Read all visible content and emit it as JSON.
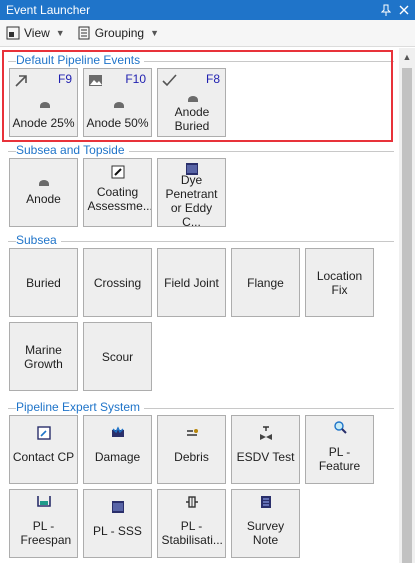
{
  "window": {
    "title": "Event Launcher",
    "pin_icon": "pin-icon",
    "close_icon": "close-icon"
  },
  "toolbar": {
    "view_label": "View",
    "grouping_label": "Grouping"
  },
  "groups": [
    {
      "title": "Default Pipeline Events",
      "tiles": [
        {
          "label": "Anode 25%",
          "key": "F9",
          "icon": "arrow-up-right-icon"
        },
        {
          "label": "Anode 50%",
          "key": "F10",
          "icon": "image-icon"
        },
        {
          "label": "Anode Buried",
          "key": "F8",
          "icon": "checkmark-icon"
        }
      ]
    },
    {
      "title": "Subsea and Topside",
      "tiles": [
        {
          "label": "Anode",
          "icon": "anode-icon"
        },
        {
          "label": "Coating Assessme...",
          "icon": "note-edit-icon"
        },
        {
          "label": "Dye Penetrant or Eddy C...",
          "icon": "wave-scan-icon"
        }
      ]
    },
    {
      "title": "Subsea",
      "tiles": [
        {
          "label": "Buried"
        },
        {
          "label": "Crossing"
        },
        {
          "label": "Field Joint"
        },
        {
          "label": "Flange"
        },
        {
          "label": "Location Fix"
        },
        {
          "label": "Marine Growth"
        },
        {
          "label": "Scour"
        }
      ]
    },
    {
      "title": "Pipeline Expert System",
      "tiles": [
        {
          "label": "Contact CP",
          "icon": "contact-cp-icon"
        },
        {
          "label": "Damage",
          "icon": "damage-icon"
        },
        {
          "label": "Debris",
          "icon": "debris-icon"
        },
        {
          "label": "ESDV Test",
          "icon": "valve-icon"
        },
        {
          "label": "PL - Feature",
          "icon": "magnifier-icon"
        },
        {
          "label": "PL - Freespan",
          "icon": "freespan-icon"
        },
        {
          "label": "PL - SSS",
          "icon": "sonar-icon"
        },
        {
          "label": "PL - Stabilisati...",
          "icon": "stabilisation-icon"
        },
        {
          "label": "Survey Note",
          "icon": "survey-note-icon"
        }
      ]
    }
  ],
  "colors": {
    "title_bar": "#1f74c9",
    "group_title": "#1f74c9",
    "highlight": "#e8323a",
    "hotkey": "#1f1fb0"
  }
}
